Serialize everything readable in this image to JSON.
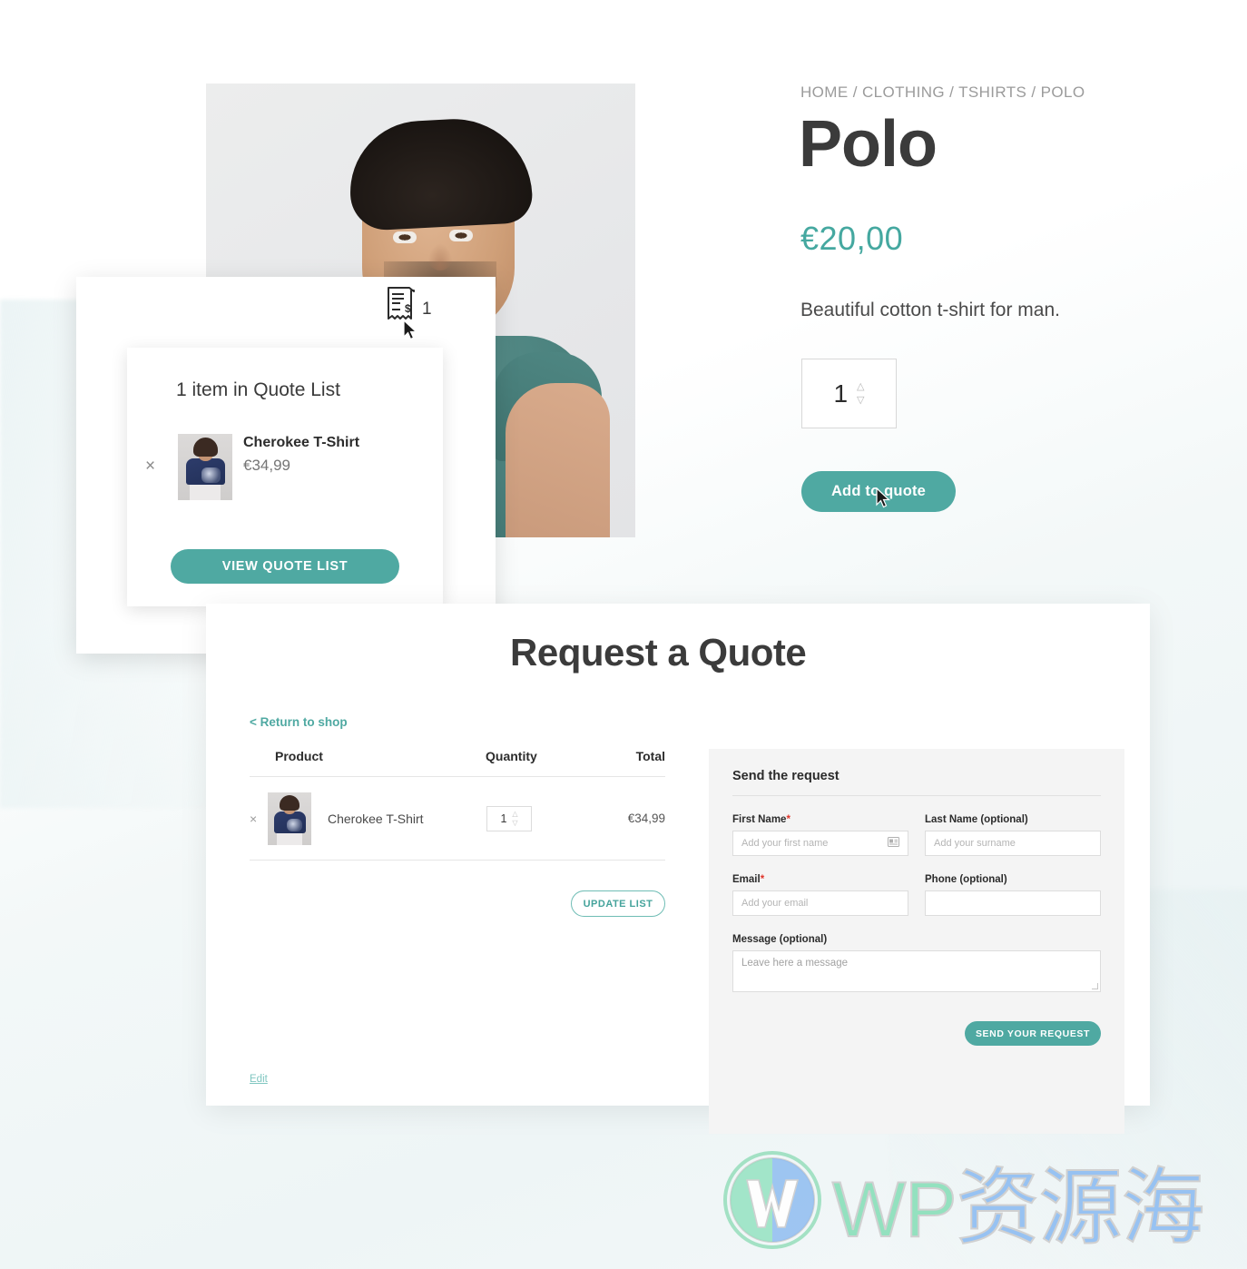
{
  "product": {
    "breadcrumb": "HOME / CLOTHING / TSHIRTS / POLO",
    "title": "Polo",
    "price": "€20,00",
    "description": "Beautiful cotton t-shirt for man.",
    "quantity": "1",
    "add_to_quote_label": "Add to quote",
    "photo_alt": "man wearing teal polo shirt"
  },
  "quote_popup": {
    "count_badge": "1",
    "icon": "receipt-icon",
    "title": "1 item in Quote List",
    "remove_label": "×",
    "item_name": "Cherokee T-Shirt",
    "item_price": "€34,99",
    "view_button_label": "VIEW QUOTE LIST"
  },
  "request": {
    "title": "Request a Quote",
    "return_to_shop": "< Return to shop",
    "table": {
      "headers": [
        "Product",
        "Quantity",
        "Total"
      ],
      "rows": [
        {
          "remove": "×",
          "name": "Cherokee T-Shirt",
          "quantity": "1",
          "total": "€34,99"
        }
      ]
    },
    "update_list_label": "UPDATE LIST",
    "edit_label": "Edit"
  },
  "form": {
    "title": "Send the request",
    "fields": [
      {
        "label": "First Name",
        "required": true,
        "placeholder": "Add your first name",
        "value": "",
        "icon": "contact-card-icon"
      },
      {
        "label": "Last Name (optional)",
        "required": false,
        "placeholder": "Add your surname",
        "value": ""
      },
      {
        "label": "Email",
        "required": true,
        "placeholder": "Add your email",
        "value": ""
      },
      {
        "label": "Phone (optional)",
        "required": false,
        "placeholder": "",
        "value": ""
      }
    ],
    "message_label": "Message (optional)",
    "message_placeholder": "Leave here a message",
    "submit_label": "SEND YOUR REQUEST",
    "required_marker": "*"
  },
  "watermark": {
    "wp": "WP",
    "cn": "资源海"
  },
  "colors": {
    "accent_teal": "#4fa9a2",
    "price_teal": "#45a8a0",
    "text_dark": "#3b3b3b",
    "muted": "#9b9b9b",
    "required_red": "#e0352b",
    "form_bg": "#f4f4f4"
  }
}
